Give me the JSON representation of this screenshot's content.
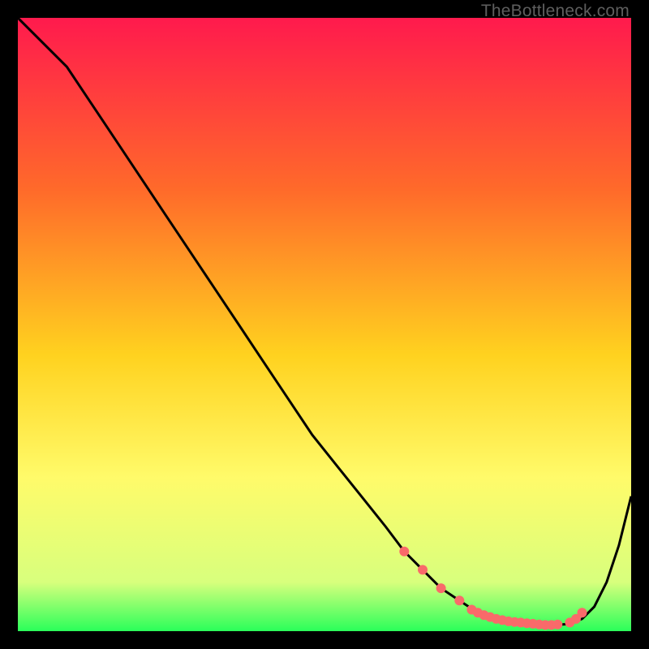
{
  "watermark": "TheBottleneck.com",
  "colors": {
    "gradient_top": "#ff1a4d",
    "gradient_mid1": "#ff6a2a",
    "gradient_mid2": "#ffd21f",
    "gradient_mid3": "#fffb6a",
    "gradient_bottom": "#2aff5a",
    "curve": "#000000",
    "marker": "#f96a6a"
  },
  "chart_data": {
    "type": "line",
    "title": "",
    "xlabel": "",
    "ylabel": "",
    "xlim": [
      0,
      100
    ],
    "ylim": [
      0,
      100
    ],
    "series": [
      {
        "name": "bottleneck-curve",
        "x": [
          0,
          4,
          8,
          12,
          16,
          20,
          24,
          28,
          32,
          36,
          40,
          44,
          48,
          52,
          56,
          60,
          63,
          66,
          69,
          72,
          75,
          78,
          81,
          84,
          86,
          88,
          90,
          92,
          94,
          96,
          98,
          100
        ],
        "y": [
          100,
          96,
          92,
          86,
          80,
          74,
          68,
          62,
          56,
          50,
          44,
          38,
          32,
          27,
          22,
          17,
          13,
          10,
          7,
          5,
          3,
          2,
          1.5,
          1.2,
          1,
          1,
          1.2,
          2,
          4,
          8,
          14,
          22
        ]
      }
    ],
    "markers": {
      "name": "highlight-points",
      "x": [
        63,
        66,
        69,
        72,
        74,
        75,
        76,
        77,
        78,
        79,
        80,
        81,
        82,
        83,
        84,
        85,
        86,
        87,
        88,
        90,
        91,
        92
      ],
      "y": [
        13,
        10,
        7,
        5,
        3.5,
        3,
        2.6,
        2.3,
        2,
        1.8,
        1.6,
        1.5,
        1.4,
        1.3,
        1.2,
        1.1,
        1,
        1,
        1.1,
        1.4,
        2,
        3
      ]
    }
  }
}
